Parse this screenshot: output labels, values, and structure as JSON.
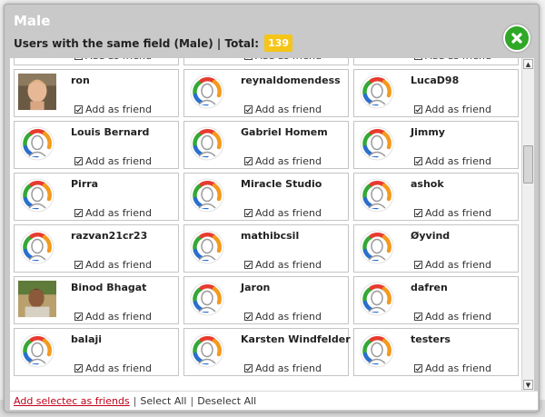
{
  "modal": {
    "title": "Male",
    "subtitle": "Users with the same field (Male) | Total:",
    "total": "139"
  },
  "add_label": "Add as friend",
  "users": [
    {
      "name": "",
      "avatar": "default",
      "partial": true
    },
    {
      "name": "",
      "avatar": "default",
      "partial": true
    },
    {
      "name": "",
      "avatar": "default",
      "partial": true
    },
    {
      "name": "ron",
      "avatar": "photo-ron"
    },
    {
      "name": "reynaldomendess",
      "avatar": "default"
    },
    {
      "name": "LucaD98",
      "avatar": "default"
    },
    {
      "name": "Louis Bernard",
      "avatar": "default"
    },
    {
      "name": "Gabriel Homem",
      "avatar": "default"
    },
    {
      "name": "Jimmy",
      "avatar": "default"
    },
    {
      "name": "Pirra",
      "avatar": "default"
    },
    {
      "name": "Miracle Studio",
      "avatar": "default"
    },
    {
      "name": "ashok",
      "avatar": "default"
    },
    {
      "name": "razvan21cr23",
      "avatar": "default"
    },
    {
      "name": "mathibcsil",
      "avatar": "default"
    },
    {
      "name": "Øyvind",
      "avatar": "default"
    },
    {
      "name": "Binod Bhagat",
      "avatar": "photo-binod"
    },
    {
      "name": "Jaron",
      "avatar": "default"
    },
    {
      "name": "dafren",
      "avatar": "default"
    },
    {
      "name": "balaji",
      "avatar": "default"
    },
    {
      "name": "Karsten Windfelder",
      "avatar": "default"
    },
    {
      "name": "testers",
      "avatar": "default"
    }
  ],
  "footer": {
    "add_selected": "Add selectec as friends",
    "separator": "|",
    "select_all": "Select All",
    "deselect_all": "Deselect All"
  },
  "colors": {
    "header_bg": "#c9c9c9",
    "badge": "#f5c518",
    "close_button": "#2fa827",
    "link_red": "#c0001a"
  }
}
